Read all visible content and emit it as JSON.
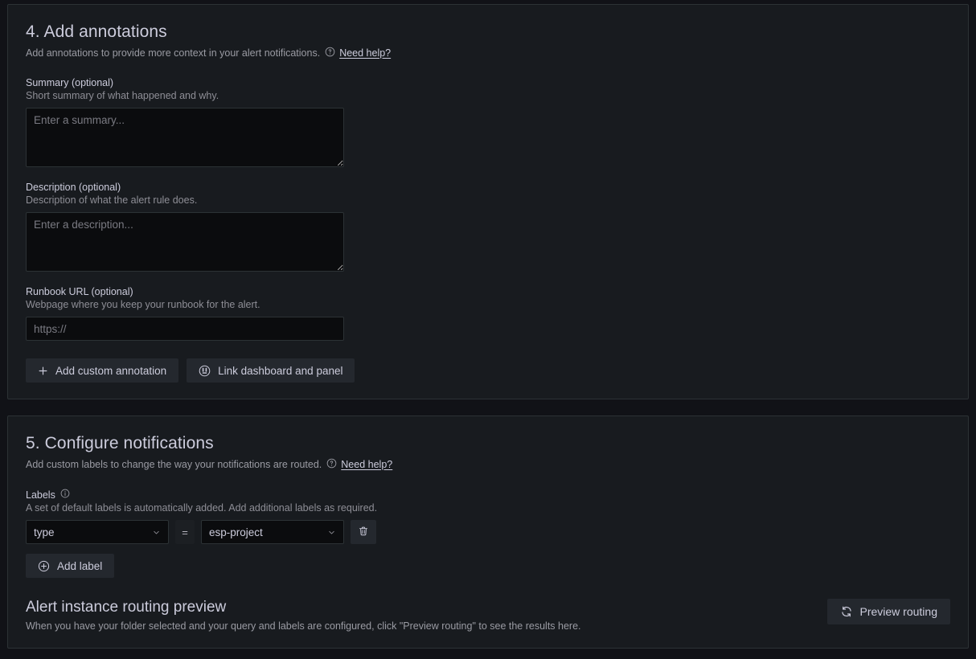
{
  "annotations": {
    "section_title": "4. Add annotations",
    "section_subtitle": "Add annotations to provide more context in your alert notifications.",
    "help_label": "Need help?",
    "help_icon": "question-circle-icon",
    "summary": {
      "label": "Summary (optional)",
      "description": "Short summary of what happened and why.",
      "placeholder": "Enter a summary...",
      "value": ""
    },
    "description": {
      "label": "Description (optional)",
      "description": "Description of what the alert rule does.",
      "placeholder": "Enter a description...",
      "value": ""
    },
    "runbook": {
      "label": "Runbook URL (optional)",
      "description": "Webpage where you keep your runbook for the alert.",
      "placeholder": "https://",
      "value": ""
    },
    "add_custom_annotation_label": "Add custom annotation",
    "add_custom_annotation_icon": "plus-icon",
    "link_dashboard_label": "Link dashboard and panel",
    "link_dashboard_icon": "apps-circle-icon"
  },
  "notifications": {
    "section_title": "5. Configure notifications",
    "section_subtitle": "Add custom labels to change the way your notifications are routed.",
    "help_label": "Need help?",
    "help_icon": "question-circle-icon",
    "labels_title": "Labels",
    "labels_info_icon": "info-circle-icon",
    "labels_description": "A set of default labels is automatically added. Add additional labels as required.",
    "label_rows": [
      {
        "key": "type",
        "operator": "=",
        "value": "esp-project",
        "delete_icon": "trash-icon"
      }
    ],
    "add_label_button": "Add label",
    "add_label_icon": "plus-circle-icon",
    "routing_preview_title": "Alert instance routing preview",
    "routing_preview_description": "When you have your folder selected and your query and labels are configured, click \"Preview routing\" to see the results here.",
    "preview_routing_button": "Preview routing",
    "preview_routing_icon": "sync-icon"
  },
  "theme": {
    "page_background": "#111217",
    "panel_background": "#181b1f",
    "panel_border": "#2c3235",
    "input_background": "#0b0c0e",
    "button_background": "#24282e",
    "text_primary": "#ccccdc",
    "text_secondary": "#9a9ba3"
  }
}
